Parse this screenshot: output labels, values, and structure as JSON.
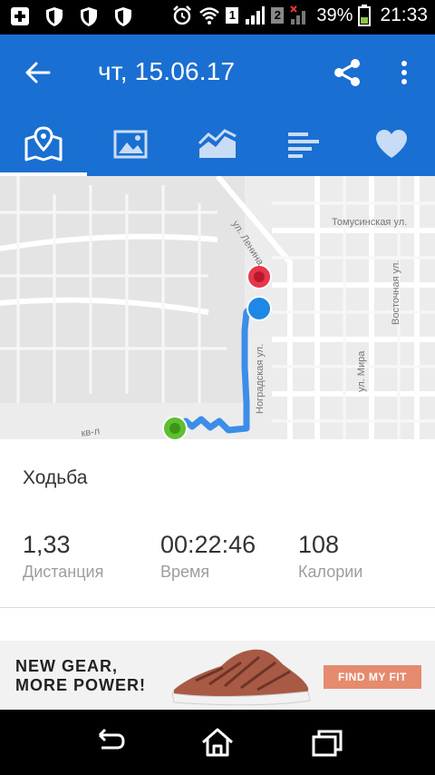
{
  "status_bar": {
    "battery_percent": "39%",
    "time": "21:33",
    "sim1_label": "1",
    "sim2_label": "2"
  },
  "app_bar": {
    "title": "чт, 15.06.17"
  },
  "tabs": [
    {
      "icon": "map-icon",
      "active": true
    },
    {
      "icon": "photo-icon",
      "active": false
    },
    {
      "icon": "chart-icon",
      "active": false
    },
    {
      "icon": "bars-icon",
      "active": false
    },
    {
      "icon": "heart-icon",
      "active": false
    }
  ],
  "map": {
    "street_labels": {
      "lenina": "ул. Ленина",
      "tomusinskaya": "Томусинская ул.",
      "vostochnaya": "Восточная ул.",
      "mira": "ул. Мира",
      "nogradskaya": "Ноградская ул.",
      "kvl": "кв-л"
    },
    "marker_colors": {
      "end": "#e8354b",
      "current": "#1e88e5",
      "start": "#5fbf2f"
    },
    "route_color": "#3b8ee8"
  },
  "workout": {
    "activity": "Ходьба",
    "stats": [
      {
        "value": "1,33",
        "label": "Дистанция"
      },
      {
        "value": "00:22:46",
        "label": "Время"
      },
      {
        "value": "108",
        "label": "Калории"
      }
    ]
  },
  "ad": {
    "headline_line1": "NEW GEAR,",
    "headline_line2": "MORE POWER!",
    "cta": "FIND MY FIT"
  },
  "colors": {
    "primary": "#1a6fd2"
  }
}
